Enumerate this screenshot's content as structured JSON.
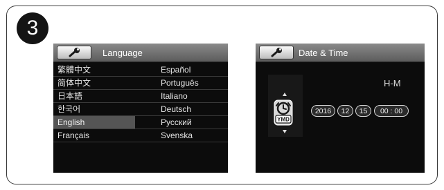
{
  "step_number": "3",
  "language_screen": {
    "title": "Language",
    "left_column": [
      "繁體中文",
      "简体中文",
      "日本語",
      "한국어",
      "English",
      "Français"
    ],
    "right_column": [
      "Español",
      "Português",
      "Italiano",
      "Deutsch",
      "Русский",
      "Svenska"
    ],
    "selected": "English"
  },
  "date_time_screen": {
    "title": "Date & Time",
    "format_label": "H-M",
    "icon_label": "YMD",
    "fields": {
      "year": "2016",
      "month": "12",
      "day": "15",
      "time": "00 : 00"
    }
  }
}
